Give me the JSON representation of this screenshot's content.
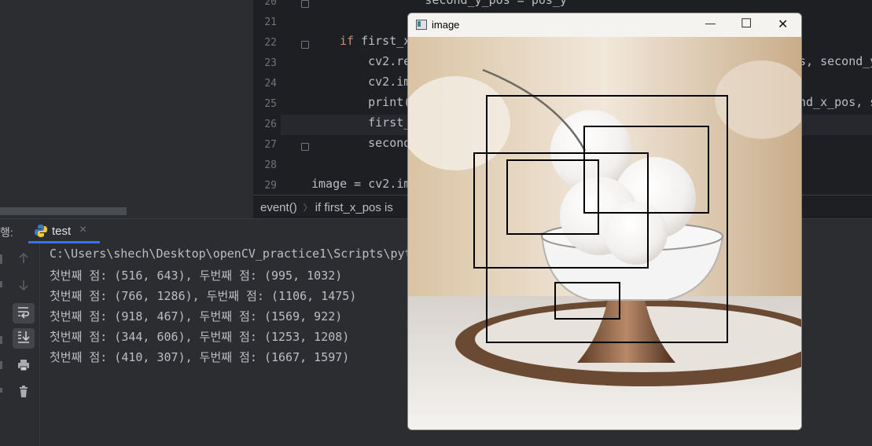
{
  "editor": {
    "lines": [
      {
        "num": "20",
        "parts": [
          {
            "t": "            second_y_pos = pos_y",
            "c": ""
          }
        ]
      },
      {
        "num": "21",
        "parts": []
      },
      {
        "num": "22",
        "parts": [
          {
            "t": "if",
            "c": "kw"
          },
          {
            "t": " first_x",
            "c": ""
          }
        ]
      },
      {
        "num": "23",
        "parts": [
          {
            "t": "    cv2.re",
            "c": ""
          }
        ]
      },
      {
        "num": "24",
        "parts": [
          {
            "t": "    cv2.im",
            "c": ""
          }
        ]
      },
      {
        "num": "25",
        "parts": [
          {
            "t": "    print(",
            "c": ""
          }
        ]
      },
      {
        "num": "26",
        "parts": [
          {
            "t": "    first_",
            "c": ""
          }
        ]
      },
      {
        "num": "27",
        "parts": [
          {
            "t": "    second",
            "c": ""
          }
        ]
      },
      {
        "num": "28",
        "parts": []
      },
      {
        "num": "29",
        "parts": [
          {
            "t": "image = cv2.im",
            "c": ""
          }
        ]
      }
    ],
    "right_fragments": [
      {
        "text": "s, second_y",
        "line": 3
      },
      {
        "text": "nd_x_pos, s",
        "line": 5
      }
    ],
    "breadcrumb_1": "event()",
    "breadcrumb_sep": "〉",
    "breadcrumb_2": "if first_x_pos is"
  },
  "run": {
    "label": "행:",
    "tab": "test",
    "tab_close": "×",
    "output": [
      "C:\\Users\\shech\\Desktop\\openCV_practice1\\Scripts\\pyt",
      "첫번째 점: (516, 643), 두번째 점: (995, 1032)",
      "첫번째 점: (766, 1286), 두번째 점: (1106, 1475)",
      "첫번째 점: (918, 467), 두번째 점: (1569, 922)",
      "첫번째 점: (344, 606), 두번째 점: (1253, 1208)",
      "첫번째 점: (410, 307), 두번째 점: (1667, 1597)"
    ]
  },
  "cv_window": {
    "title": "image",
    "minimize": "—",
    "maximize": "☐",
    "close": "✕"
  },
  "colors": {
    "editor_bg": "#1e1f22",
    "ide_bg": "#2b2d30",
    "keyword": "#cf8e6d"
  }
}
